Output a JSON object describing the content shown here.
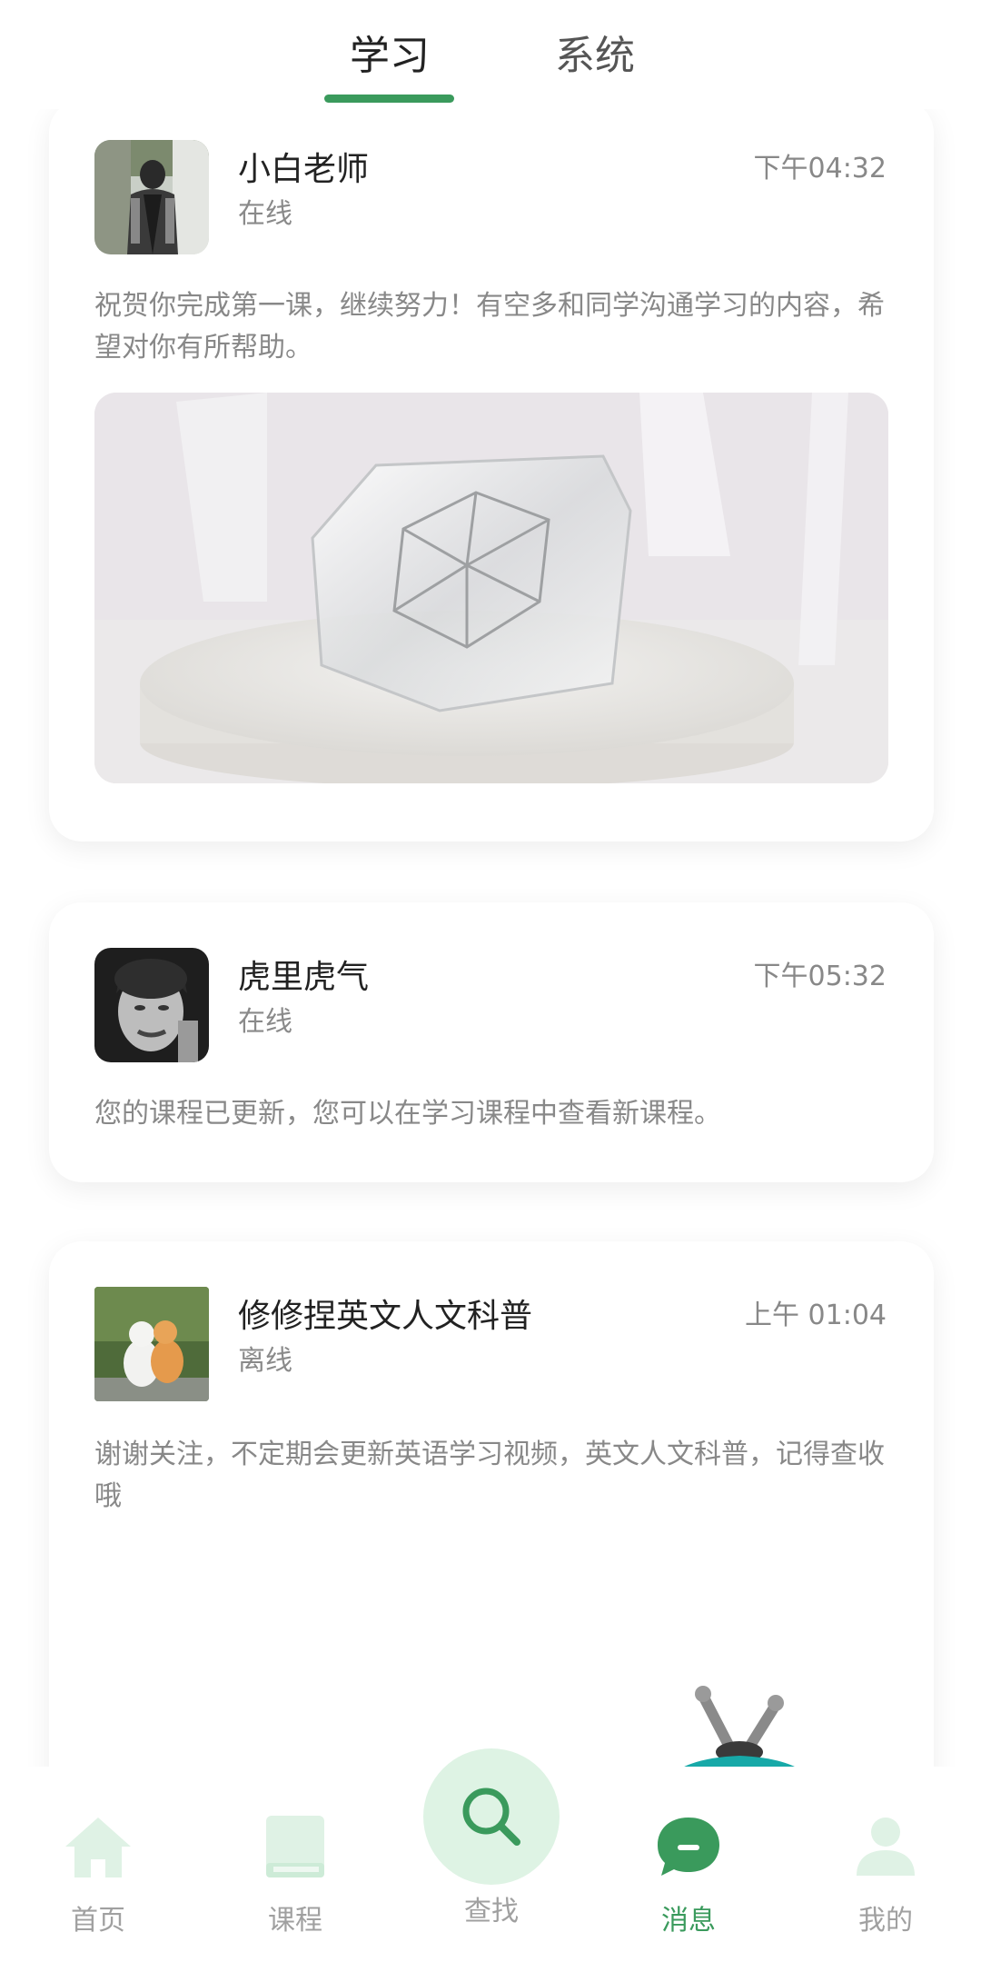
{
  "header": {
    "tabs": [
      {
        "label": "学习",
        "active": true
      },
      {
        "label": "系统",
        "active": false
      }
    ],
    "accent_color": "#3a9a5c"
  },
  "messages": [
    {
      "name": "小白老师",
      "status": "在线",
      "time": "下午04:32",
      "text": "祝贺你完成第一课，继续努力！有空多和同学沟通学习的内容，希望对你有所帮助。",
      "has_image": true
    },
    {
      "name": "虎里虎气",
      "status": "在线",
      "time": "下午05:32",
      "text": "您的课程已更新，您可以在学习课程中查看新课程。",
      "has_image": false
    },
    {
      "name": "修修捏英文人文科普",
      "status": "离线",
      "time": "上午 01:04",
      "text": "谢谢关注，不定期会更新英语学习视频，英文人文科普，记得查收哦",
      "has_image": false
    }
  ],
  "bottom_nav": {
    "items": [
      {
        "label": "首页",
        "icon": "home-icon",
        "active": false
      },
      {
        "label": "课程",
        "icon": "book-icon",
        "active": false
      },
      {
        "label": "查找",
        "icon": "search-icon",
        "active": false
      },
      {
        "label": "消息",
        "icon": "chat-icon",
        "active": true
      },
      {
        "label": "我的",
        "icon": "user-icon",
        "active": false
      }
    ],
    "active_color": "#3a9a5c",
    "inactive_icon_color": "#dff2e5"
  }
}
